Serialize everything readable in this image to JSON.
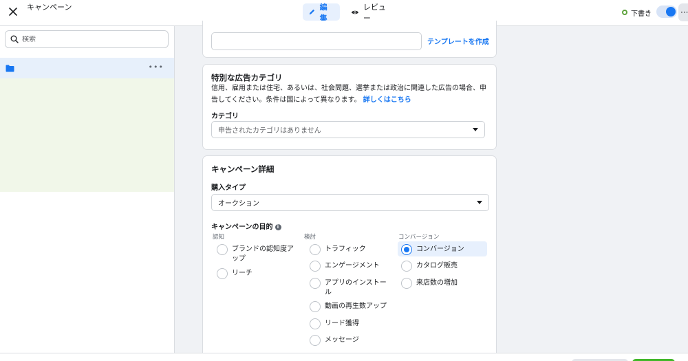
{
  "header": {
    "title": "キャンペーン",
    "edit_label": "編集",
    "review_label": "レビュー",
    "draft_label": "下書き",
    "more_label": "···"
  },
  "sidebar": {
    "search_placeholder": "検索",
    "more_label": "•••"
  },
  "name_section": {
    "template_link": "テンプレートを作成"
  },
  "special_category": {
    "title": "特別な広告カテゴリ",
    "description": "信用、雇用または住宅、あるいは、社会問題、選挙または政治に関連した広告の場合、申告してください。条件は国によって異なります。",
    "learn_more": "詳しくはこちら",
    "category_label": "カテゴリ",
    "category_placeholder": "申告されたカテゴリはありません"
  },
  "campaign_details": {
    "title": "キャンペーン詳細",
    "buying_type_label": "購入タイプ",
    "buying_type_value": "オークション",
    "objective_label": "キャンペーンの目的",
    "columns": [
      {
        "heading": "認知",
        "options": [
          "ブランドの認知度アップ",
          "リーチ"
        ]
      },
      {
        "heading": "検討",
        "options": [
          "トラフィック",
          "エンゲージメント",
          "アプリのインストール",
          "動画の再生数アップ",
          "リード獲得",
          "メッセージ"
        ]
      },
      {
        "heading": "コンバージョン",
        "options": [
          "コンバージョン",
          "カタログ販売",
          "来店数の増加"
        ]
      }
    ],
    "selected_objective": "コンバージョン"
  },
  "colors": {
    "accent": "#1877f2",
    "selected_bg": "#e7f0fd",
    "adset_bg": "#f1f7e9",
    "draft_green": "#5ea33d",
    "publish_green": "#42b72a"
  }
}
